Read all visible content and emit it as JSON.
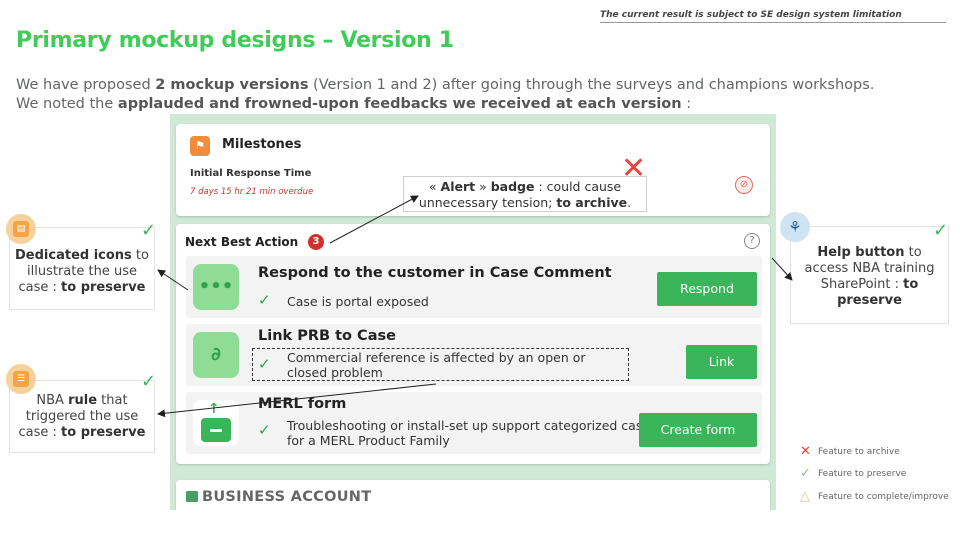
{
  "top_note": "The current result is subject to SE design system limitation",
  "title": "Primary mockup designs – Version 1",
  "intro": {
    "p1": "We have proposed ",
    "b1": "2 mockup versions",
    "p2": " (Version 1 and 2) after going through the surveys and champions workshops. We noted the ",
    "b2": "applauded and frowned-upon feedbacks we received at each version",
    "p3": " :"
  },
  "milestones": {
    "title": "Milestones",
    "subtitle": "Initial Response Time",
    "overdue": "7 days 15 hr 21 min overdue"
  },
  "nba": {
    "header": "Next Best Action",
    "badge_count": "3",
    "help_glyph": "?",
    "rows": [
      {
        "title": "Respond to the customer in Case Comment",
        "description": "Case is portal exposed",
        "button": "Respond"
      },
      {
        "title": "Link PRB to Case",
        "description": "Commercial reference is affected by an open or closed problem",
        "button": "Link"
      },
      {
        "title": "MERL form",
        "description": "Troubleshooting or install-set up support categorized case for a MERL Product Family",
        "button": "Create form"
      }
    ]
  },
  "business_account": "BUSINESS ACCOUNT",
  "annotations": {
    "alert": {
      "q_open": "« ",
      "b1": "Alert",
      "q_close": " » ",
      "b2": "badge",
      "p1": " : could cause unnecessary tension; ",
      "b3": "to archive",
      "p2": "."
    },
    "icons": {
      "b1": "Dedicated icons",
      "p1": " to illustrate the use case : ",
      "b2": "to preserve"
    },
    "rule": {
      "p1": "NBA ",
      "b1": "rule",
      "p2": " that triggered the use case : ",
      "b2": "to preserve"
    },
    "help": {
      "b1": "Help button",
      "p1": " to access NBA training SharePoint : ",
      "b2": "to preserve"
    }
  },
  "legend": {
    "archive": "Feature to archive",
    "preserve": "Feature to preserve",
    "improve": "Feature to complete/improve"
  },
  "colors": {
    "title_green": "#3dcd58",
    "button_green": "#3ab55a",
    "mock_bg": "#cfe9d6",
    "alert_red": "#d32f2f",
    "archive_red": "#e8463c"
  },
  "icons": {
    "milestones": "milestone-flag-icon",
    "stop": "stop-icon",
    "help": "help-icon",
    "comment": "chat-bubble-icon",
    "link": "link-icon",
    "form": "mail-upload-icon",
    "business_account": "account-card-icon",
    "annotation_icons": "icon-tool-icon",
    "annotation_rule": "rule-icon",
    "annotation_help": "training-hierarchy-icon"
  }
}
